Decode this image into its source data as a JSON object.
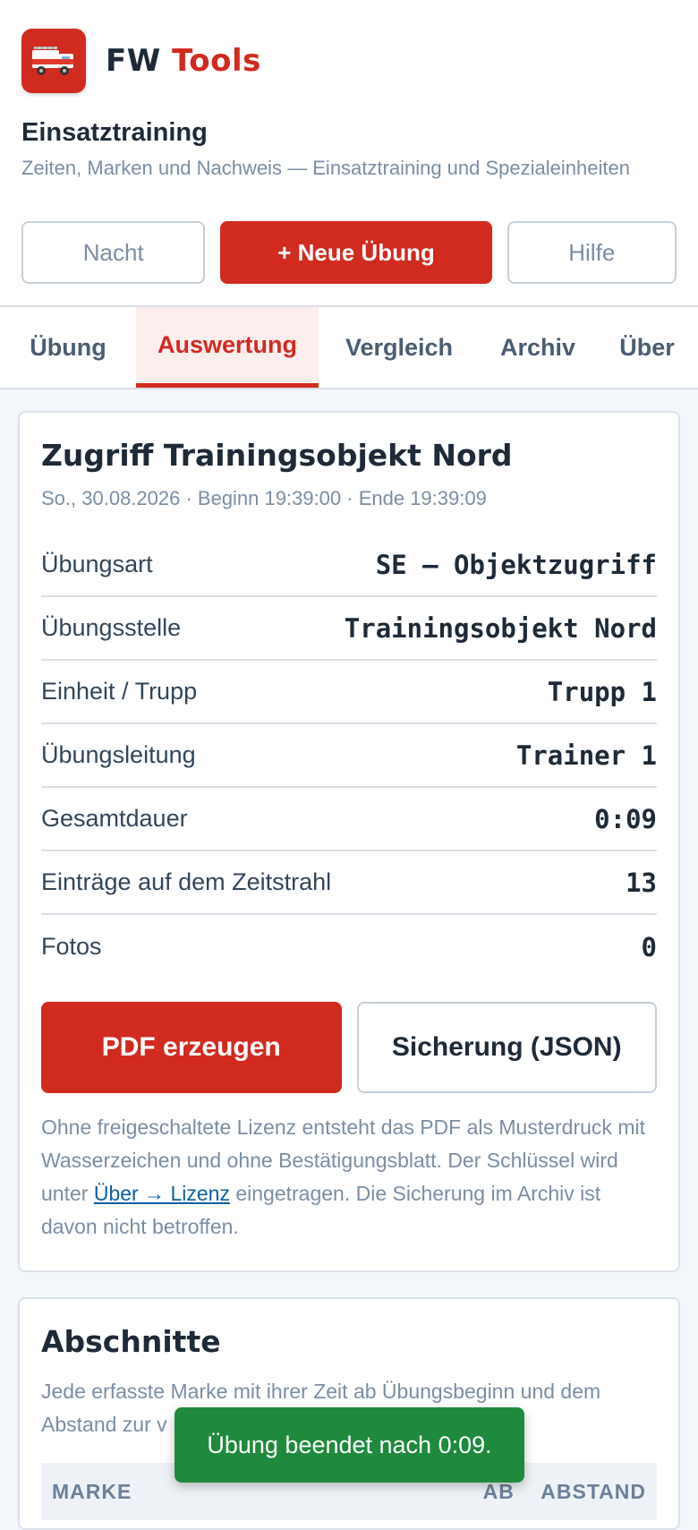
{
  "brand": {
    "name_part1": "FW",
    "name_part2": "Tools",
    "logo_icon": "fire-truck-icon"
  },
  "app": {
    "title": "Einsatztraining",
    "subtitle": "Zeiten, Marken und Nachweis — Einsatztraining und Spezialeinheiten"
  },
  "actions": {
    "night": "Nacht",
    "new_exercise": "+ Neue Übung",
    "help": "Hilfe"
  },
  "tabs": [
    {
      "label": "Übung",
      "active": false
    },
    {
      "label": "Auswertung",
      "active": true
    },
    {
      "label": "Vergleich",
      "active": false
    },
    {
      "label": "Archiv",
      "active": false
    },
    {
      "label": "Über",
      "active": false
    }
  ],
  "summary": {
    "title": "Zugriff Trainingsobjekt Nord",
    "meta": "So., 30.08.2026 · Beginn 19:39:00 · Ende 19:39:09",
    "rows": [
      {
        "label": "Übungsart",
        "value": "SE — Objektzugriff"
      },
      {
        "label": "Übungsstelle",
        "value": "Trainingsobjekt Nord"
      },
      {
        "label": "Einheit / Trupp",
        "value": "Trupp 1"
      },
      {
        "label": "Übungsleitung",
        "value": "Trainer 1"
      },
      {
        "label": "Gesamtdauer",
        "value": "0:09"
      },
      {
        "label": "Einträge auf dem Zeitstrahl",
        "value": "13"
      },
      {
        "label": "Fotos",
        "value": "0"
      }
    ],
    "pdf_button": "PDF erzeugen",
    "backup_button": "Sicherung (JSON)",
    "note_before": "Ohne freigeschaltete Lizenz entsteht das PDF als Musterdruck mit Wasserzeichen und ohne Bestätigungsblatt. Der Schlüssel wird unter ",
    "note_link": "Über → Lizenz",
    "note_after": " eingetragen. Die Sicherung im Archiv ist davon nicht betroffen."
  },
  "sections": {
    "title": "Abschnitte",
    "description": "Jede erfasste Marke mit ihrer Zeit ab Übungsbeginn und dem Abstand zur v",
    "columns": {
      "mark": "MARKE",
      "from": "AB",
      "gap": "ABSTAND"
    }
  },
  "toast": "Übung beendet nach 0:09.",
  "colors": {
    "accent": "#d12a1f",
    "success": "#1f8a3d",
    "muted": "#7b8ea3"
  }
}
